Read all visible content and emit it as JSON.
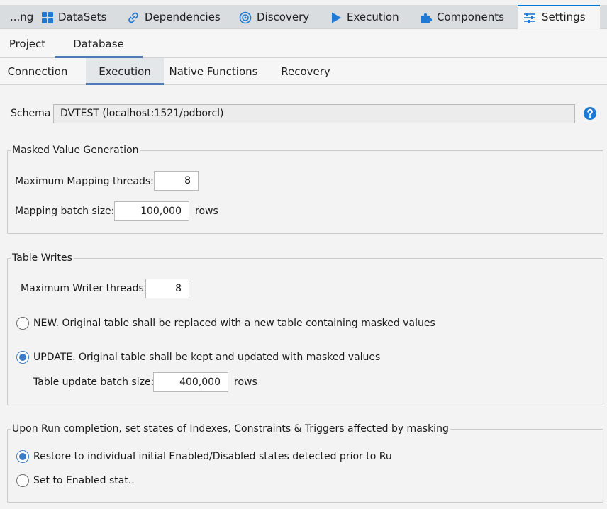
{
  "top_tabs": [
    {
      "label": "...ng",
      "icon": "none"
    },
    {
      "label": "DataSets",
      "icon": "grid-icon"
    },
    {
      "label": "Dependencies",
      "icon": "link-icon"
    },
    {
      "label": "Discovery",
      "icon": "target-icon"
    },
    {
      "label": "Execution",
      "icon": "play-icon"
    },
    {
      "label": "Components",
      "icon": "puzzle-icon"
    },
    {
      "label": "Settings",
      "icon": "sliders-icon",
      "active": true
    }
  ],
  "subtabs_level1": [
    {
      "label": "Project"
    },
    {
      "label": "Database",
      "active": true
    }
  ],
  "subtabs_level2": [
    {
      "label": "Connection"
    },
    {
      "label": "Execution",
      "active": true
    },
    {
      "label": "Native Functions"
    },
    {
      "label": "Recovery"
    }
  ],
  "schema": {
    "label": "Schema",
    "value": "DVTEST (localhost:1521/pdborcl)"
  },
  "masked_value_generation": {
    "title": "Masked Value Generation",
    "mapping_threads_label": "Maximum Mapping threads:",
    "mapping_threads_value": "8",
    "batch_size_label": "Mapping batch size:",
    "batch_size_value": "100,000",
    "batch_size_unit": "rows"
  },
  "table_writes": {
    "title": "Table Writes",
    "writer_threads_label": "Maximum Writer threads:",
    "writer_threads_value": "8",
    "option_new": "NEW. Original table shall be replaced with a new table containing masked values",
    "option_update": "UPDATE. Original table shall be kept and updated with masked values",
    "selected": "update",
    "update_batch_label": "Table update batch size:",
    "update_batch_value": "400,000",
    "update_batch_unit": "rows"
  },
  "run_completion": {
    "title": "Upon Run completion, set states of Indexes, Constraints & Triggers affected by masking",
    "option_restore": "Restore to individual initial Enabled/Disabled states detected prior to Ru",
    "option_enabled": "Set to Enabled stat..",
    "selected": "restore"
  },
  "colors": {
    "accent": "#0078d7",
    "tab_strip": "#d9dde0",
    "radio_checked": "#3a7dc9",
    "icon_blue": "#1f7ad6"
  }
}
